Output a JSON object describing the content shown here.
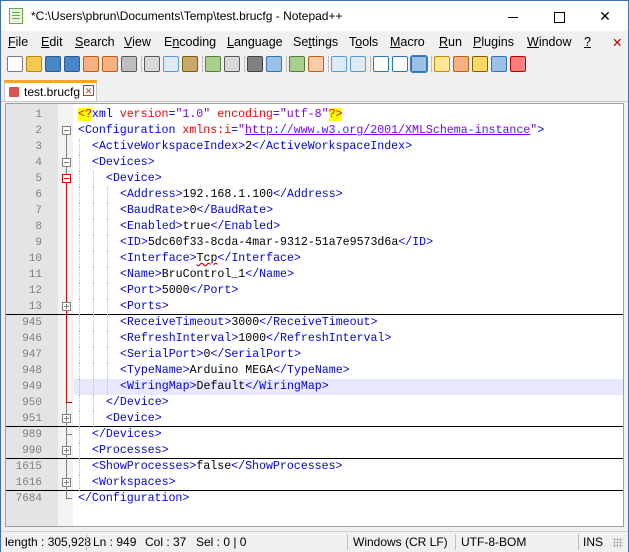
{
  "window": {
    "title": "*C:\\Users\\pbrun\\Documents\\Temp\\test.brucfg - Notepad++",
    "close_glyph": "✕"
  },
  "menu": [
    {
      "pre": "",
      "mn": "F",
      "post": "ile"
    },
    {
      "pre": "",
      "mn": "E",
      "post": "dit"
    },
    {
      "pre": "",
      "mn": "S",
      "post": "earch"
    },
    {
      "pre": "",
      "mn": "V",
      "post": "iew"
    },
    {
      "pre": "E",
      "mn": "n",
      "post": "coding"
    },
    {
      "pre": "",
      "mn": "L",
      "post": "anguage"
    },
    {
      "pre": "Se",
      "mn": "t",
      "post": "tings"
    },
    {
      "pre": "T",
      "mn": "o",
      "post": "ols"
    },
    {
      "pre": "",
      "mn": "M",
      "post": "acro"
    },
    {
      "pre": "",
      "mn": "R",
      "post": "un"
    },
    {
      "pre": "",
      "mn": "P",
      "post": "lugins"
    },
    {
      "pre": "",
      "mn": "W",
      "post": "indow"
    },
    {
      "pre": "",
      "mn": "?",
      "post": ""
    }
  ],
  "menu_close_glyph": "✕",
  "toolbar": [
    {
      "name": "new-file-icon",
      "color": "#ffffff",
      "border": "#7a7a7a"
    },
    {
      "name": "open-file-icon",
      "color": "#f2c94c",
      "border": "#b8860b"
    },
    {
      "name": "save-icon",
      "color": "#4a86c8",
      "border": "#2b5c8a"
    },
    {
      "name": "save-all-icon",
      "color": "#4a86c8",
      "border": "#2b5c8a"
    },
    {
      "name": "close-file-icon",
      "color": "#f4b183",
      "border": "#c55a11"
    },
    {
      "name": "close-all-icon",
      "color": "#f4b183",
      "border": "#c55a11"
    },
    {
      "name": "print-icon",
      "color": "#bfbfbf",
      "border": "#595959"
    },
    {
      "sep": true
    },
    {
      "name": "cut-icon",
      "color": "#d9d9d9",
      "border": "#595959"
    },
    {
      "name": "copy-icon",
      "color": "#ddebf7",
      "border": "#5b9bd5"
    },
    {
      "name": "paste-icon",
      "color": "#c9a66b",
      "border": "#7f6000"
    },
    {
      "sep": true
    },
    {
      "name": "undo-icon",
      "color": "#a9d08e",
      "border": "#548235"
    },
    {
      "name": "redo-icon",
      "color": "#d9d9d9",
      "border": "#595959"
    },
    {
      "sep": true
    },
    {
      "name": "find-icon",
      "color": "#808080",
      "border": "#404040"
    },
    {
      "name": "replace-icon",
      "color": "#9bc2e6",
      "border": "#2f75b5"
    },
    {
      "sep": true
    },
    {
      "name": "zoom-in-icon",
      "color": "#a9d08e",
      "border": "#548235"
    },
    {
      "name": "zoom-out-icon",
      "color": "#f8cbad",
      "border": "#c55a11"
    },
    {
      "sep": true
    },
    {
      "name": "sync-vertical-icon",
      "color": "#ddebf7",
      "border": "#5b9bd5"
    },
    {
      "name": "sync-horizontal-icon",
      "color": "#ddebf7",
      "border": "#5b9bd5"
    },
    {
      "sep": true
    },
    {
      "name": "word-wrap-icon",
      "color": "#ffffff",
      "border": "#2f75b5"
    },
    {
      "name": "show-all-chars-icon",
      "color": "#ffffff",
      "border": "#2f75b5"
    },
    {
      "name": "indent-guide-icon",
      "color": "#9bc2e6",
      "border": "#2f75b5",
      "active": true
    },
    {
      "sep": true
    },
    {
      "name": "user-defined-lang-icon",
      "color": "#ffe699",
      "border": "#bf9000"
    },
    {
      "name": "doc-map-icon",
      "color": "#f4b183",
      "border": "#c55a11"
    },
    {
      "name": "function-list-icon",
      "color": "#ffd966",
      "border": "#7f6000"
    },
    {
      "name": "folder-workspace-icon",
      "color": "#9bc2e6",
      "border": "#2f75b5"
    },
    {
      "name": "monitoring-icon",
      "color": "#ff7c80",
      "border": "#c00000"
    }
  ],
  "tab": {
    "label": "test.brucfg",
    "close_glyph": "✕"
  },
  "lines": [
    {
      "n": "1",
      "d": 0,
      "fold": "",
      "tokens": [
        [
          "pi",
          "<?"
        ],
        [
          "tag",
          "xml "
        ],
        [
          "attr",
          "version"
        ],
        [
          "tag",
          "="
        ],
        [
          "val",
          "\"1.0\""
        ],
        [
          "tag",
          " "
        ],
        [
          "attr",
          "encoding"
        ],
        [
          "tag",
          "="
        ],
        [
          "val",
          "\"utf-8\""
        ],
        [
          "pi",
          "?>"
        ]
      ]
    },
    {
      "n": "2",
      "d": 0,
      "fold": "minus",
      "tokens": [
        [
          "tag",
          "<Configuration "
        ],
        [
          "attr",
          "xmlns:i"
        ],
        [
          "tag",
          "="
        ],
        [
          "val",
          "\""
        ],
        [
          "url",
          "http://www.w3.org/2001/XMLSchema-instance"
        ],
        [
          "val",
          "\""
        ],
        [
          "tag",
          ">"
        ]
      ]
    },
    {
      "n": "3",
      "d": 1,
      "fold": "",
      "tokens": [
        [
          "tag",
          "<ActiveWorkspaceIndex>"
        ],
        [
          "txt",
          "2"
        ],
        [
          "tag",
          "</ActiveWorkspaceIndex>"
        ]
      ]
    },
    {
      "n": "4",
      "d": 1,
      "fold": "minus",
      "tokens": [
        [
          "tag",
          "<Devices>"
        ]
      ]
    },
    {
      "n": "5",
      "d": 2,
      "fold": "minus-red",
      "tokens": [
        [
          "tag",
          "<Device>"
        ]
      ]
    },
    {
      "n": "6",
      "d": 3,
      "fold": "",
      "tokens": [
        [
          "tag",
          "<Address>"
        ],
        [
          "txt",
          "192.168.1.100"
        ],
        [
          "tag",
          "</Address>"
        ]
      ]
    },
    {
      "n": "7",
      "d": 3,
      "fold": "",
      "tokens": [
        [
          "tag",
          "<BaudRate>"
        ],
        [
          "txt",
          "0"
        ],
        [
          "tag",
          "</BaudRate>"
        ]
      ]
    },
    {
      "n": "8",
      "d": 3,
      "fold": "",
      "tokens": [
        [
          "tag",
          "<Enabled>"
        ],
        [
          "txt",
          "true"
        ],
        [
          "tag",
          "</Enabled>"
        ]
      ]
    },
    {
      "n": "9",
      "d": 3,
      "fold": "",
      "tokens": [
        [
          "tag",
          "<ID>"
        ],
        [
          "txt",
          "5dc60f33-8cda-4mar-9312-51a7e9573d6a"
        ],
        [
          "tag",
          "</ID>"
        ]
      ]
    },
    {
      "n": "10",
      "d": 3,
      "fold": "",
      "tokens": [
        [
          "tag",
          "<Interface>"
        ],
        [
          "spell",
          "Tcp"
        ],
        [
          "tag",
          "</Interface>"
        ]
      ]
    },
    {
      "n": "11",
      "d": 3,
      "fold": "",
      "tokens": [
        [
          "tag",
          "<Name>"
        ],
        [
          "txt",
          "BruControl_1"
        ],
        [
          "tag",
          "</Name>"
        ]
      ]
    },
    {
      "n": "12",
      "d": 3,
      "fold": "",
      "tokens": [
        [
          "tag",
          "<Port>"
        ],
        [
          "txt",
          "5000"
        ],
        [
          "tag",
          "</Port>"
        ]
      ]
    },
    {
      "n": "13",
      "d": 3,
      "fold": "plus",
      "foldline": true,
      "tokens": [
        [
          "tag",
          "<Ports>"
        ]
      ]
    },
    {
      "n": "945",
      "d": 3,
      "fold": "",
      "tokens": [
        [
          "tag",
          "<ReceiveTimeout>"
        ],
        [
          "txt",
          "3000"
        ],
        [
          "tag",
          "</ReceiveTimeout>"
        ]
      ]
    },
    {
      "n": "946",
      "d": 3,
      "fold": "",
      "tokens": [
        [
          "tag",
          "<RefreshInterval>"
        ],
        [
          "txt",
          "1000"
        ],
        [
          "tag",
          "</RefreshInterval>"
        ]
      ]
    },
    {
      "n": "947",
      "d": 3,
      "fold": "",
      "tokens": [
        [
          "tag",
          "<SerialPort>"
        ],
        [
          "txt",
          "0"
        ],
        [
          "tag",
          "</SerialPort>"
        ]
      ]
    },
    {
      "n": "948",
      "d": 3,
      "fold": "",
      "tokens": [
        [
          "tag",
          "<TypeName>"
        ],
        [
          "txt",
          "Arduino MEGA"
        ],
        [
          "tag",
          "</TypeName>"
        ]
      ]
    },
    {
      "n": "949",
      "d": 3,
      "fold": "",
      "cur": true,
      "tokens": [
        [
          "tag",
          "<WiringMap>"
        ],
        [
          "txt",
          "Default"
        ],
        [
          "tag",
          "</WiringMap>"
        ]
      ]
    },
    {
      "n": "950",
      "d": 2,
      "fold": "end-red",
      "tokens": [
        [
          "tag",
          "</Device>"
        ]
      ]
    },
    {
      "n": "951",
      "d": 2,
      "fold": "plus",
      "foldline": true,
      "tokens": [
        [
          "tag",
          "<Device>"
        ]
      ]
    },
    {
      "n": "989",
      "d": 1,
      "fold": "end",
      "tokens": [
        [
          "tag",
          "</Devices>"
        ]
      ]
    },
    {
      "n": "990",
      "d": 1,
      "fold": "plus",
      "foldline": true,
      "tokens": [
        [
          "tag",
          "<Processes>"
        ]
      ]
    },
    {
      "n": "1615",
      "d": 1,
      "fold": "",
      "tokens": [
        [
          "tag",
          "<ShowProcesses>"
        ],
        [
          "txt",
          "false"
        ],
        [
          "tag",
          "</ShowProcesses>"
        ]
      ]
    },
    {
      "n": "1616",
      "d": 1,
      "fold": "plus",
      "foldline": true,
      "tokens": [
        [
          "tag",
          "<Workspaces>"
        ]
      ]
    },
    {
      "n": "7684",
      "d": 0,
      "fold": "end",
      "tokens": [
        [
          "tag",
          "</Configuration>"
        ]
      ]
    }
  ],
  "status": {
    "length": "length : 305,928",
    "ln": "Ln : 949",
    "col": "Col : 37",
    "sel": "Sel : 0 | 0",
    "eol": "Windows (CR LF)",
    "encoding": "UTF-8-BOM",
    "ins": "INS"
  }
}
